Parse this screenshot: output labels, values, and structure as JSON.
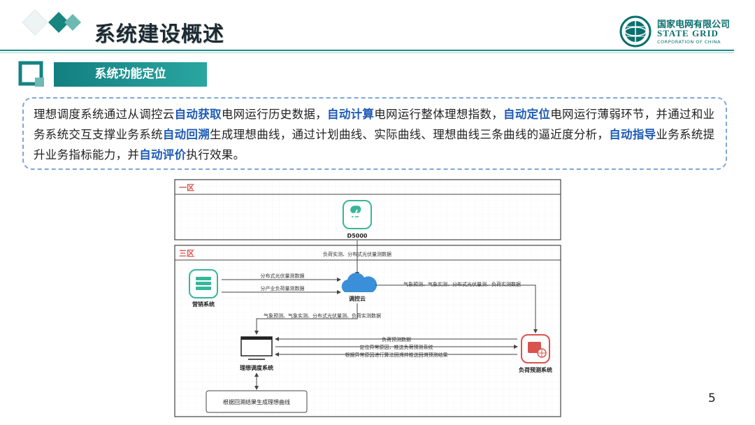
{
  "header": {
    "title": "系统建设概述",
    "logo": {
      "cn": "国家电网有限公司",
      "en_line1": "STATE GRID",
      "en_line2": "CORPORATION OF CHINA"
    }
  },
  "section": {
    "title": "系统功能定位"
  },
  "intro_segments": [
    {
      "text": "理想调度系统通过从调控云",
      "highlight": false
    },
    {
      "text": "自动获取",
      "highlight": true
    },
    {
      "text": "电网运行历史数据，",
      "highlight": false
    },
    {
      "text": "自动计算",
      "highlight": true
    },
    {
      "text": "电网运行整体理想指数，",
      "highlight": false
    },
    {
      "text": "自动定位",
      "highlight": true
    },
    {
      "text": "电网运行薄弱环节，并通过和业务系统交互支撑业务系统",
      "highlight": false
    },
    {
      "text": "自动回溯",
      "highlight": true
    },
    {
      "text": "生成理想曲线，通过计划曲线、实际曲线、理想曲线三条曲线的逼近度分析，",
      "highlight": false
    },
    {
      "text": "自动指导",
      "highlight": true
    },
    {
      "text": "业务系统提升业务指标能力，并",
      "highlight": false
    },
    {
      "text": "自动评价",
      "highlight": true
    },
    {
      "text": "执行效果。",
      "highlight": false
    }
  ],
  "diagram": {
    "zone1_label": "一区",
    "zone3_label": "三区",
    "d5000": "D5000",
    "cloud": "调控云",
    "marketing": "营销系统",
    "ideal": "理想调度系统",
    "forecast": "负荷预测系统",
    "result_box": "根据回溯结果生成理想曲线",
    "flow_d5000_cloud": "负荷实测、分布式光伏量测数据",
    "flow_mkt_1": "分布式光伏量测数据",
    "flow_mkt_2": "分产业负荷量测数据",
    "flow_cloud_forecast": "气象预测、气象实测、分布式光伏量测、负荷实测数据",
    "flow_cloud_ideal": "气象预测、气象实测、分布式光伏量测、负荷实测数据",
    "flow_forecast_1": "负荷预测数据",
    "flow_forecast_2": "定位异常原因，推送负荷预测系统",
    "flow_forecast_3": "根据异常原因进行算法回溯并推送回溯预测结果"
  },
  "page_number": "5",
  "colors": {
    "teal": "#1a8c8a",
    "highlight_blue": "#1f5cb5",
    "zone_red": "#d9534f",
    "dashed_border": "#7fa6d6"
  }
}
